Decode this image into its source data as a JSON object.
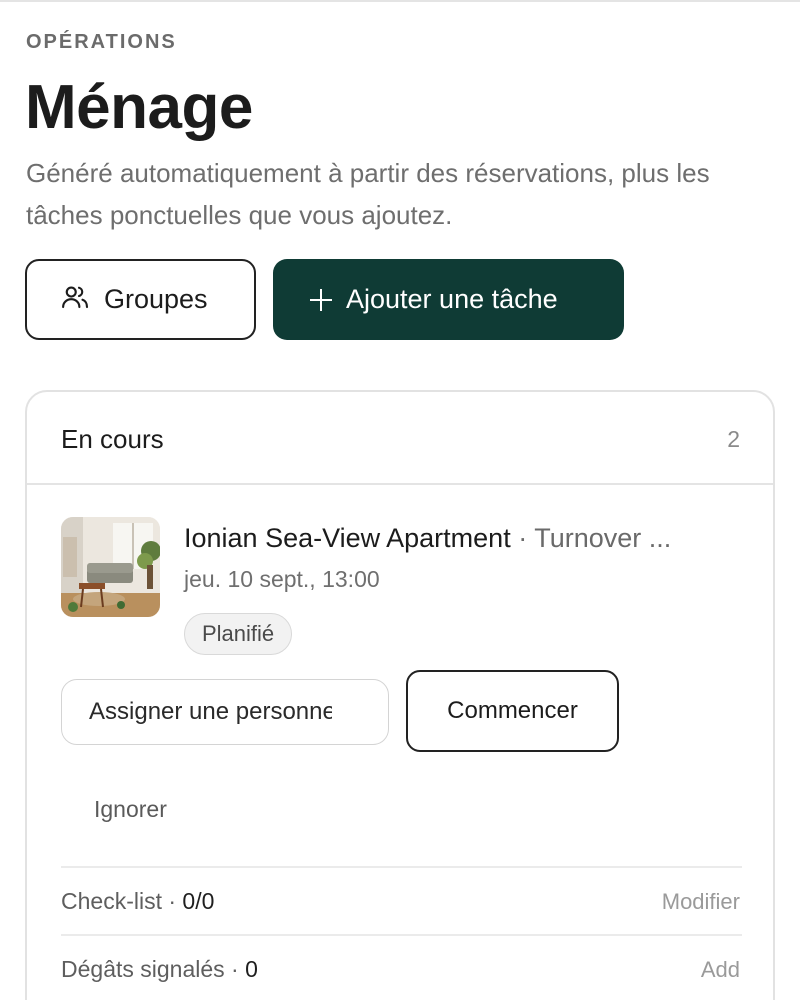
{
  "header": {
    "eyebrow": "OPÉRATIONS",
    "title": "Ménage",
    "subtitle": "Généré automatiquement à partir des réservations, plus les tâches ponctuelles que vous ajoutez."
  },
  "actions": {
    "groups_label": "Groupes",
    "add_task_label": "Ajouter une tâche"
  },
  "section": {
    "title": "En cours",
    "count": "2"
  },
  "task": {
    "property": "Ionian Sea-View Apartment",
    "separator": "·",
    "type": "Turnover ...",
    "datetime": "jeu. 10 sept., 13:00",
    "status": "Planifié",
    "assign_value": "Assigner une personne",
    "start_label": "Commencer",
    "ignore_label": "Ignorer",
    "checklist_label": "Check-list ·",
    "checklist_value": "0/0",
    "checklist_action": "Modifier",
    "damages_label": "Dégâts signalés ·",
    "damages_value": "0",
    "damages_action": "Add"
  },
  "colors": {
    "primary": "#0f3b35",
    "text": "#1c1c1c",
    "muted": "#6e6e6e"
  },
  "icons": {
    "groups": "users-icon",
    "add": "plus-icon"
  }
}
